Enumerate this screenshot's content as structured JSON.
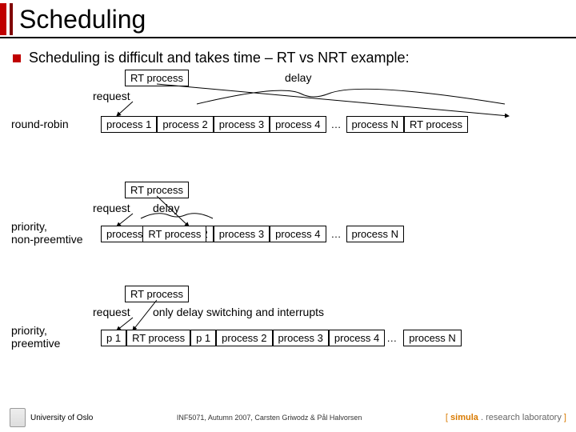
{
  "title": "Scheduling",
  "bullet_text": "Scheduling is difficult and takes time – RT vs NRT example:",
  "labels": {
    "round_robin": "round-robin",
    "priority_nonpre": "priority,\nnon-preemtive",
    "priority_pre": "priority,\npreemtive",
    "request": "request",
    "delay": "delay",
    "only_delay": "only delay switching and interrupts",
    "dots": "…",
    "dots2": "…"
  },
  "rr": {
    "rt_box": "RT process",
    "row": [
      "process 1",
      "process 2",
      "process 3",
      "process 4"
    ],
    "tail": [
      "process N",
      "RT process"
    ]
  },
  "np": {
    "rt_box": "RT process",
    "row_under": [
      "process 1",
      "process 2",
      "process 3",
      "process 4"
    ],
    "rt_over": "RT process",
    "tail": [
      "process N"
    ]
  },
  "pp": {
    "rt_box": "RT process",
    "row": [
      "p 1",
      "RT process",
      "p 1",
      "process 2",
      "process 3",
      "process 4"
    ],
    "dots": "…",
    "tail": [
      "process N"
    ]
  },
  "footer": {
    "uio": "University of Oslo",
    "center": "INF5071, Autumn 2007, Carsten Griwodz & Pål Halvorsen",
    "right_open": "[ ",
    "right_simula": "simula",
    "right_dot": " . ",
    "right_rl": "research laboratory",
    "right_close": " ]"
  }
}
